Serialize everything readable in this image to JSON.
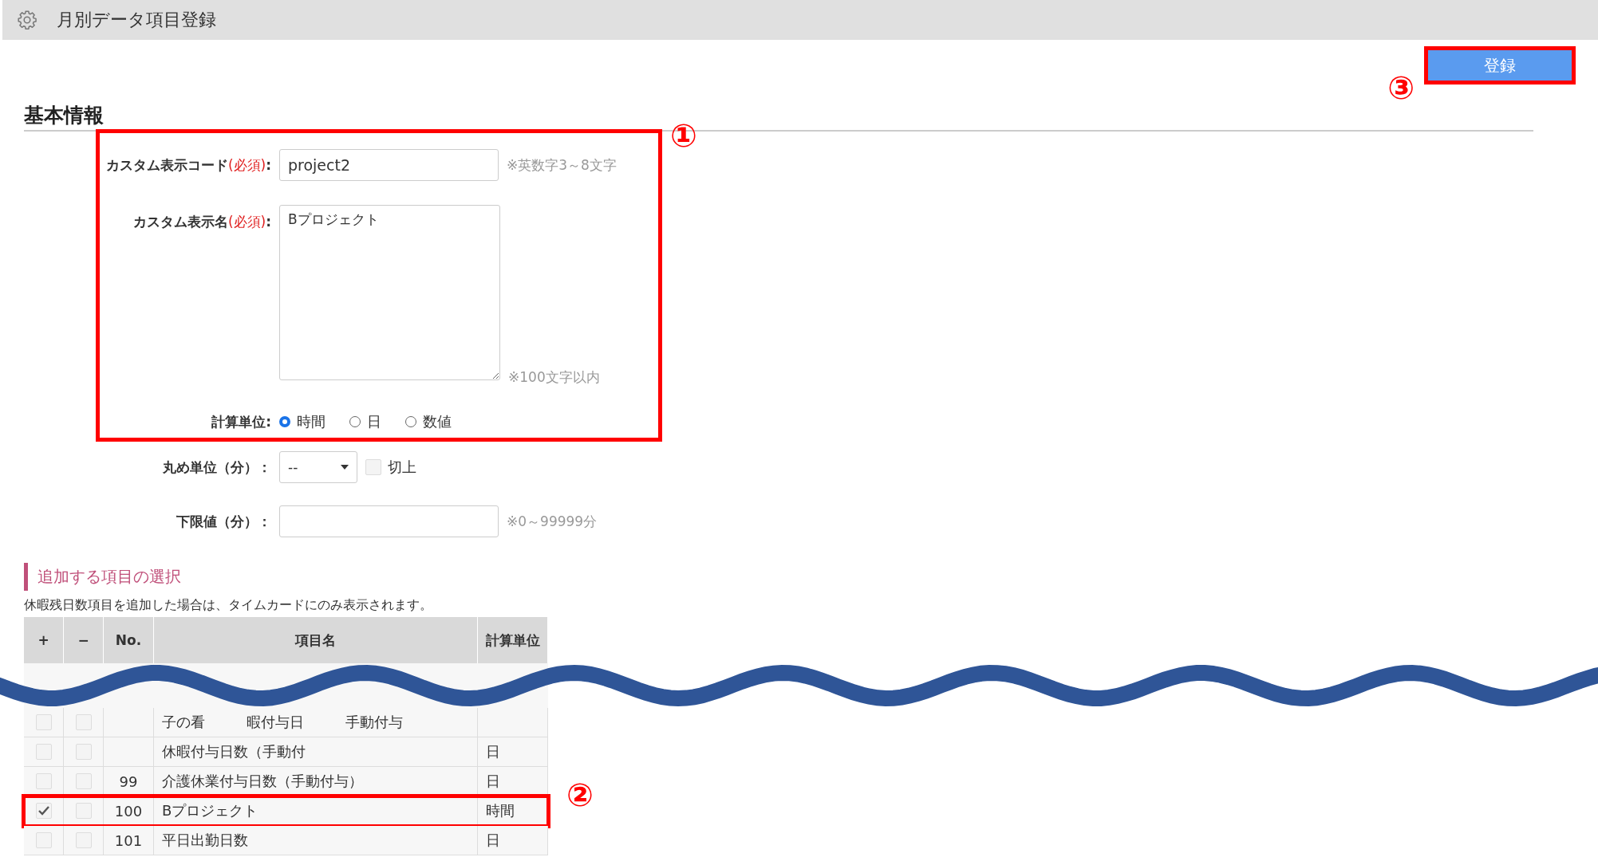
{
  "header": {
    "title": "月別データ項目登録"
  },
  "register_button": {
    "label": "登録",
    "marker": "③"
  },
  "section_title": "基本情報",
  "boxed_marker": "①",
  "custom_code": {
    "label": "カスタム表示コード",
    "required": "(必須)",
    "suffix": ":",
    "value": "project2",
    "hint": "※英数字3～8文字"
  },
  "custom_name": {
    "label": "カスタム表示名",
    "required": "(必須)",
    "suffix": ":",
    "value": "Bプロジェクト",
    "hint": "※100文字以内"
  },
  "calc_unit": {
    "label": "計算単位:",
    "options": [
      {
        "label": "時間",
        "selected": true
      },
      {
        "label": "日",
        "selected": false
      },
      {
        "label": "数値",
        "selected": false
      }
    ]
  },
  "rounding": {
    "label": "丸め単位（分）：",
    "select_value": "--",
    "roundup": {
      "label": "切上",
      "checked": false
    }
  },
  "lower_limit": {
    "label": "下限値（分）：",
    "hint": "※0～99999分"
  },
  "item_selection": {
    "title": "追加する項目の選択",
    "note": "休暇残日数項目を追加した場合は、タイムカードにのみ表示されます。",
    "columns": [
      "+",
      "−",
      "No.",
      "項目名",
      "計算単位"
    ],
    "rows": [
      {
        "add": false,
        "remove": false,
        "name_parts": [
          "子の看",
          "暇付与日",
          "手動付与"
        ]
      },
      {
        "add": false,
        "remove": false,
        "name_parts": [
          "休暇付与日数（手動付"
        ],
        "unit": "日"
      },
      {
        "add": false,
        "remove": false,
        "no": "99",
        "name": "介護休業付与日数（手動付与）",
        "unit": "日"
      },
      {
        "add": true,
        "remove": false,
        "no": "100",
        "name": "Bプロジェクト",
        "unit": "時間",
        "marker": "②"
      },
      {
        "add": false,
        "remove": false,
        "no": "101",
        "name": "平日出勤日数",
        "unit": "日"
      }
    ]
  }
}
